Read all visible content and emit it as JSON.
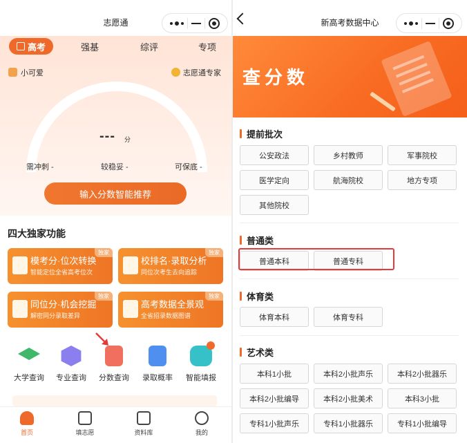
{
  "left": {
    "title": "志愿通",
    "tabs": [
      "高考",
      "强基",
      "综评",
      "专项"
    ],
    "user_name": "小可爱",
    "expert_label": "志愿通专家",
    "score_value": "---",
    "score_unit": "分",
    "gauge_labels": [
      "需冲刺 -",
      "较稳妥 -",
      "可保底 -"
    ],
    "predict_button": "输入分数智能推荐",
    "section_title": "四大独家功能",
    "features": [
      {
        "title": "模考分·位次转换",
        "subtitle": "智能定位全省高考位次",
        "badge": "独家"
      },
      {
        "title": "校排名·录取分析",
        "subtitle": "同位次考生去向追踪",
        "badge": "独家"
      },
      {
        "title": "同位分·机会挖掘",
        "subtitle": "解密同分录取差异",
        "badge": "独家"
      },
      {
        "title": "高考数据全景观",
        "subtitle": "全省招录数据图谱",
        "badge": "独家"
      }
    ],
    "services": [
      "大学查询",
      "专业查询",
      "分数查询",
      "录取概率",
      "智能填报"
    ],
    "nav": [
      "首页",
      "填志愿",
      "资料库",
      "我的"
    ]
  },
  "right": {
    "title": "新高考数据中心",
    "banner_title": "查分数",
    "sections": [
      {
        "title": "提前批次",
        "items": [
          "公安政法",
          "乡村教师",
          "军事院校",
          "医学定向",
          "航海院校",
          "地方专项",
          "其他院校"
        ]
      },
      {
        "title": "普通类",
        "items": [
          "普通本科",
          "普通专科"
        ]
      },
      {
        "title": "体育类",
        "items": [
          "体育本科",
          "体育专科"
        ]
      },
      {
        "title": "艺术类",
        "items": [
          "本科1小批",
          "本科2小批声乐",
          "本科2小批器乐",
          "本科2小批编导",
          "本科2小批美术",
          "本科3小批",
          "专科1小批声乐",
          "专科1小批器乐",
          "专科1小批编导"
        ]
      }
    ]
  },
  "colors": {
    "accent": "#ef6a2a",
    "highlight": "#e33b3b"
  }
}
